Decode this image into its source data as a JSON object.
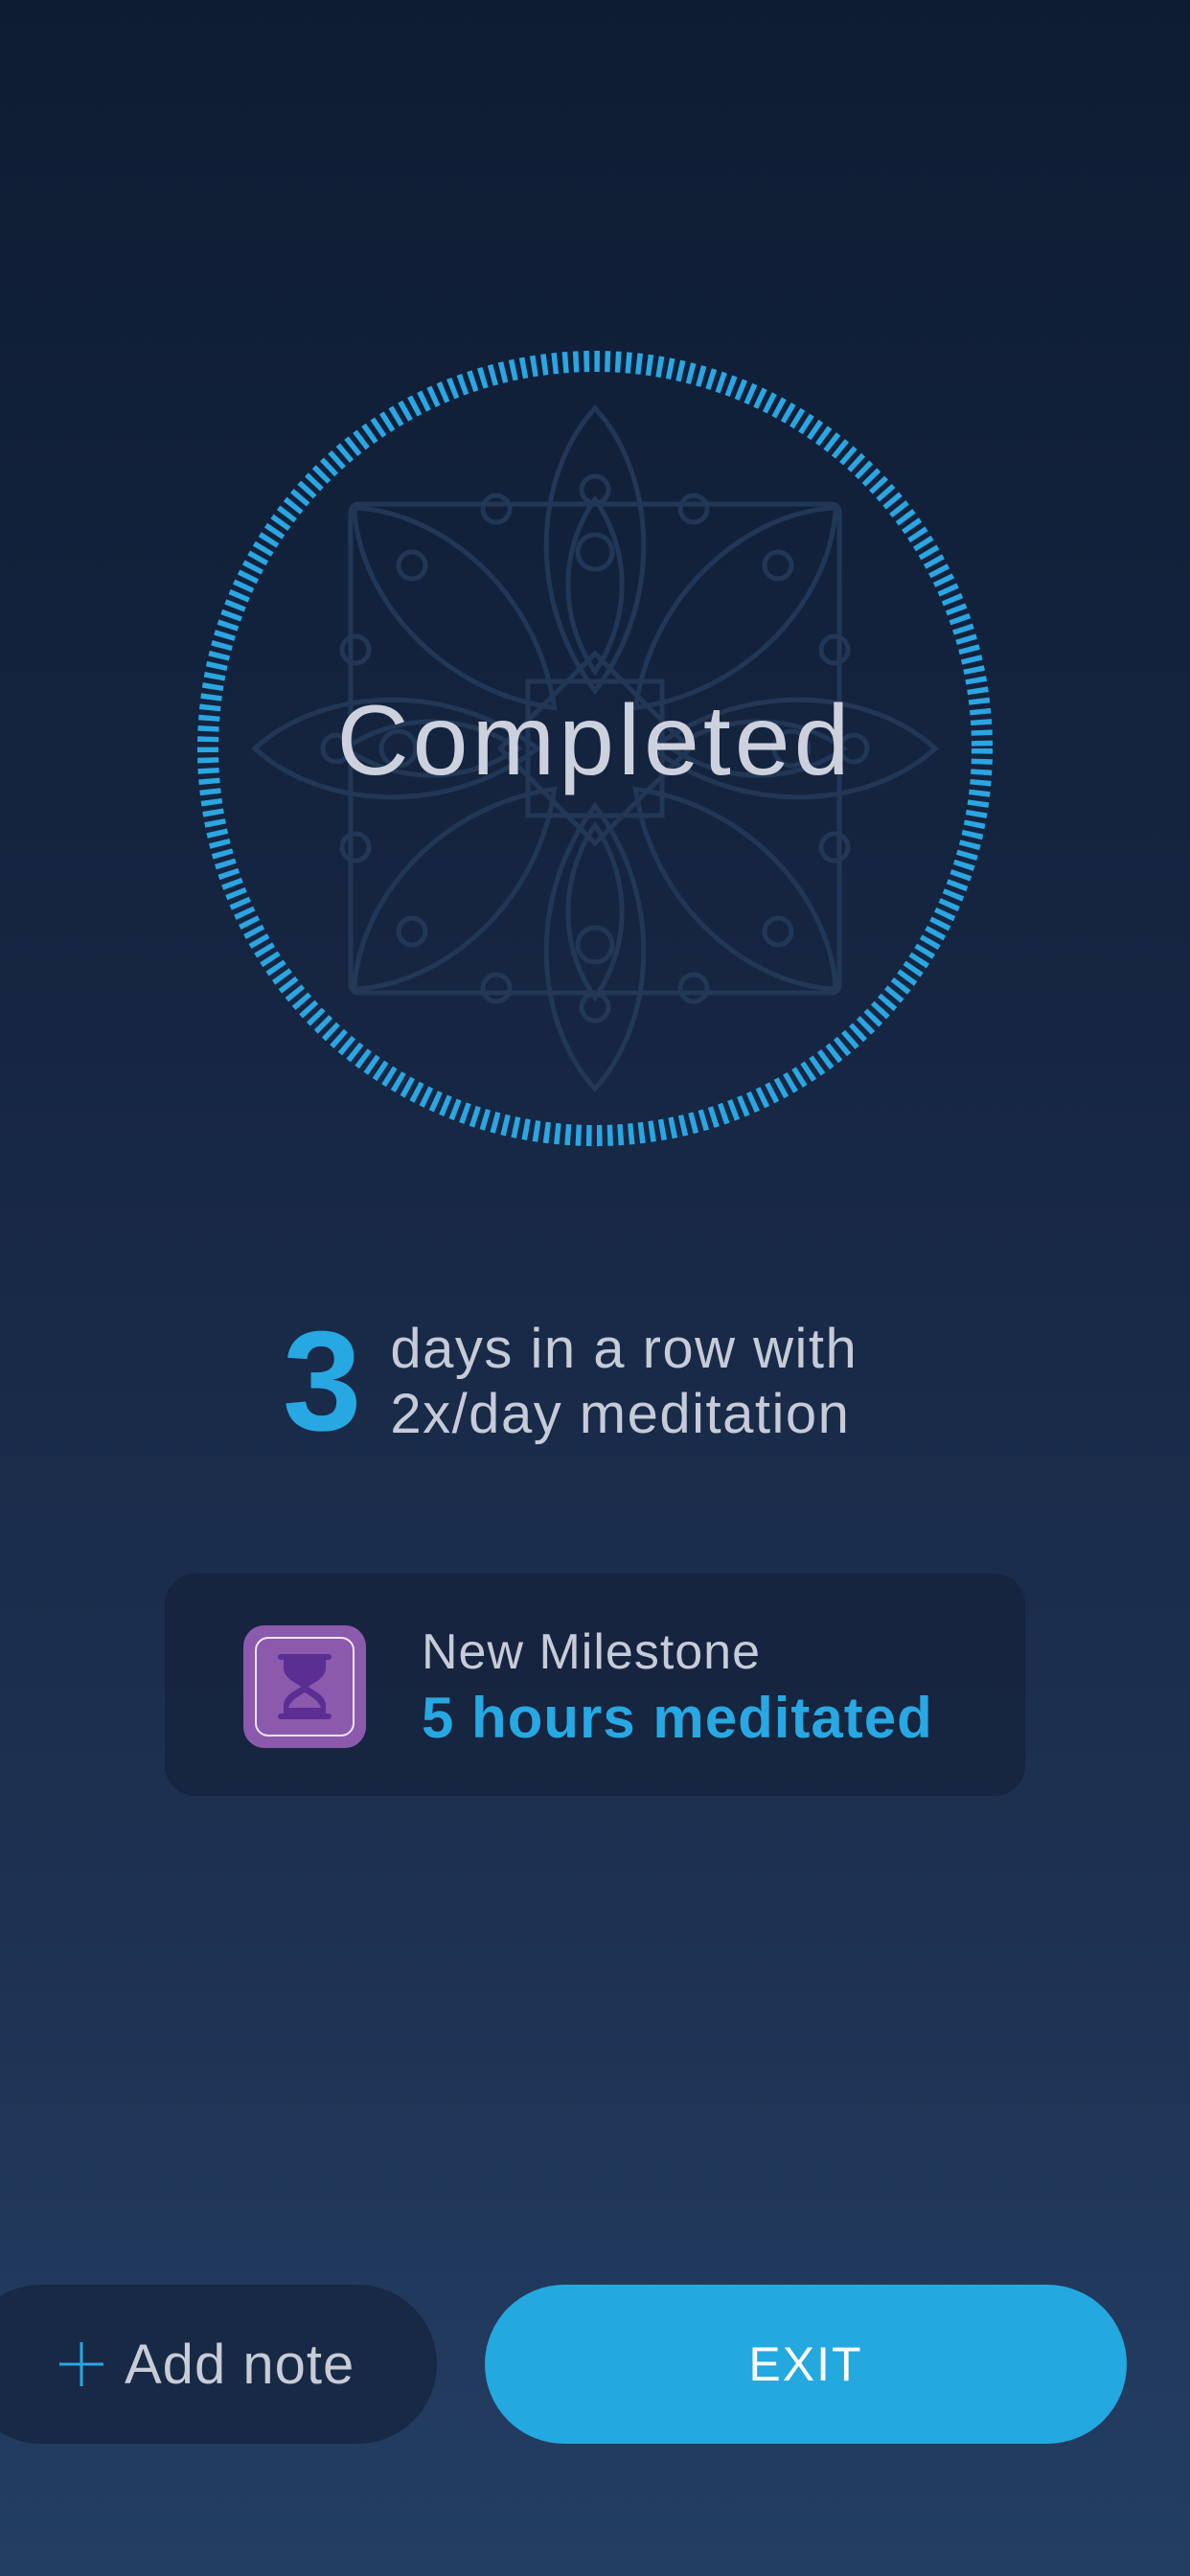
{
  "session": {
    "status_label": "Completed"
  },
  "streak": {
    "count": "3",
    "line1": "days in a row with",
    "line2": "2x/day meditation"
  },
  "milestone": {
    "kicker": "New Milestone",
    "title": "5 hours meditated",
    "icon": "hourglass-icon"
  },
  "actions": {
    "add_note_label": "Add note",
    "exit_label": "EXIT"
  },
  "colors": {
    "accent": "#24a8e0",
    "milestone_badge": "#8b5aad",
    "background_top": "#0e1c33",
    "background_bottom": "#233e63"
  }
}
